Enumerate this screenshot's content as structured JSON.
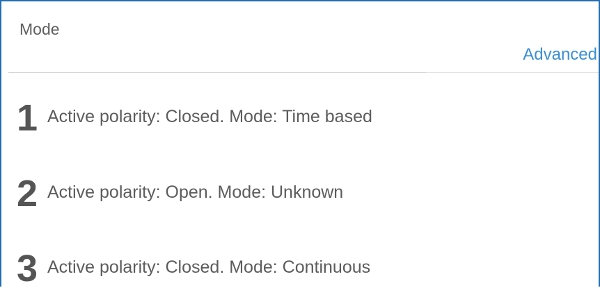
{
  "header": {
    "title": "Mode",
    "advanced_label": "Advanced"
  },
  "items": [
    {
      "number": "1",
      "text": "Active polarity: Closed. Mode: Time based"
    },
    {
      "number": "2",
      "text": "Active polarity: Open. Mode: Unknown"
    },
    {
      "number": "3",
      "text": "Active polarity: Closed. Mode: Continuous"
    }
  ],
  "colors": {
    "accent": "#3a8fd4",
    "border": "#1f6fb5",
    "text": "#5c5c5c"
  }
}
